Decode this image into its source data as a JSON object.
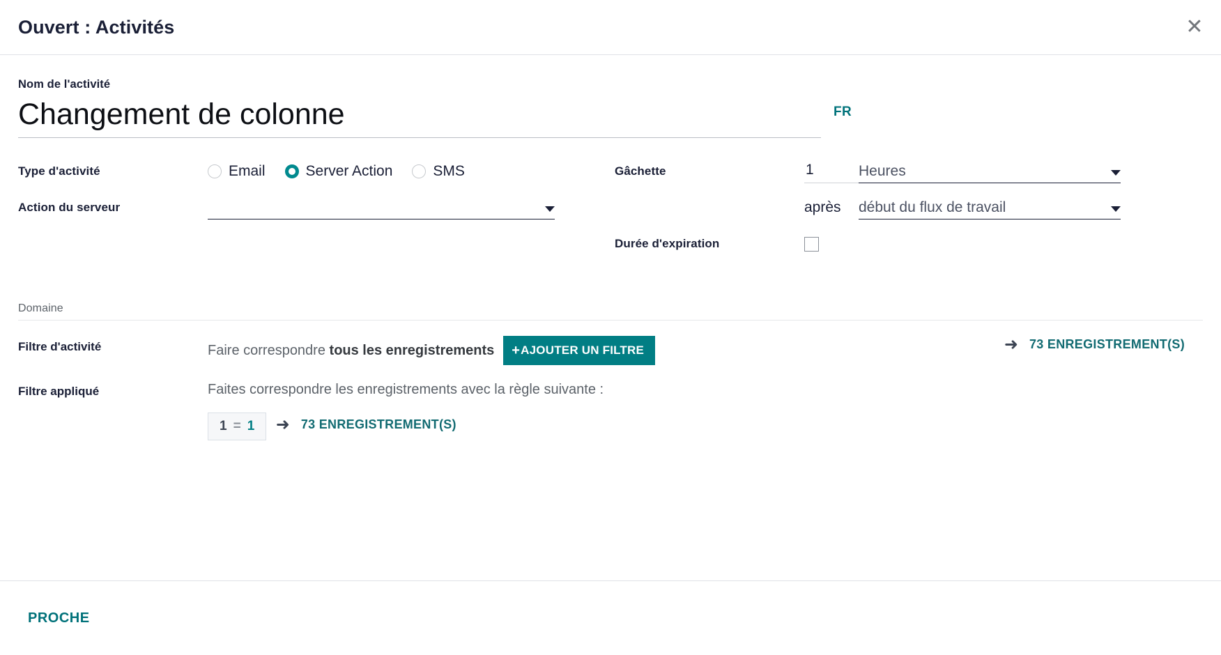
{
  "header": {
    "title": "Ouvert : Activités",
    "close_icon": "close-icon",
    "close_glyph": "✕"
  },
  "activity": {
    "name_label": "Nom de l'activité",
    "name_value": "Changement de colonne",
    "name_placeholder": "",
    "language_badge": "FR"
  },
  "type_field": {
    "label": "Type d'activité",
    "options": [
      {
        "label": "Email",
        "selected": false
      },
      {
        "label": "Server Action",
        "selected": true
      },
      {
        "label": "SMS",
        "selected": false
      }
    ]
  },
  "server_action": {
    "label": "Action du serveur",
    "value": "",
    "caret_icon": "chevron-down-icon"
  },
  "trigger": {
    "label": "Gâchette",
    "amount": "1",
    "unit": "Heures",
    "relation": "après",
    "reference": "début du flux de travail",
    "caret_icon": "chevron-down-icon"
  },
  "expiration": {
    "label": "Durée d'expiration",
    "checked": false
  },
  "domain": {
    "section_title": "Domaine",
    "activity_filter": {
      "label": "Filtre d'activité",
      "match_prefix": "Faire correspondre ",
      "match_strong": "tous les enregistrements",
      "add_filter_button": "AJOUTER UN FILTRE",
      "add_filter_plus": "+",
      "records_link": "73 ENREGISTREMENT(S)",
      "arrow_icon": "arrow-right-icon",
      "arrow_glyph": "➜"
    },
    "applied_filter": {
      "label": "Filtre appliqué",
      "rule_text": "Faites correspondre les enregistrements avec la règle suivante :",
      "chip": {
        "left": "1",
        "operator": "=",
        "right": "1"
      },
      "records_link": "73 ENREGISTREMENT(S)",
      "arrow_icon": "arrow-right-icon",
      "arrow_glyph": "➜"
    }
  },
  "footer": {
    "close_label": "PROCHE"
  },
  "colors": {
    "accent_teal": "#017e84",
    "link_teal": "#126b72",
    "text_dark": "#1a1f36",
    "text_muted": "#5c6269",
    "border": "#dfe2e6"
  }
}
